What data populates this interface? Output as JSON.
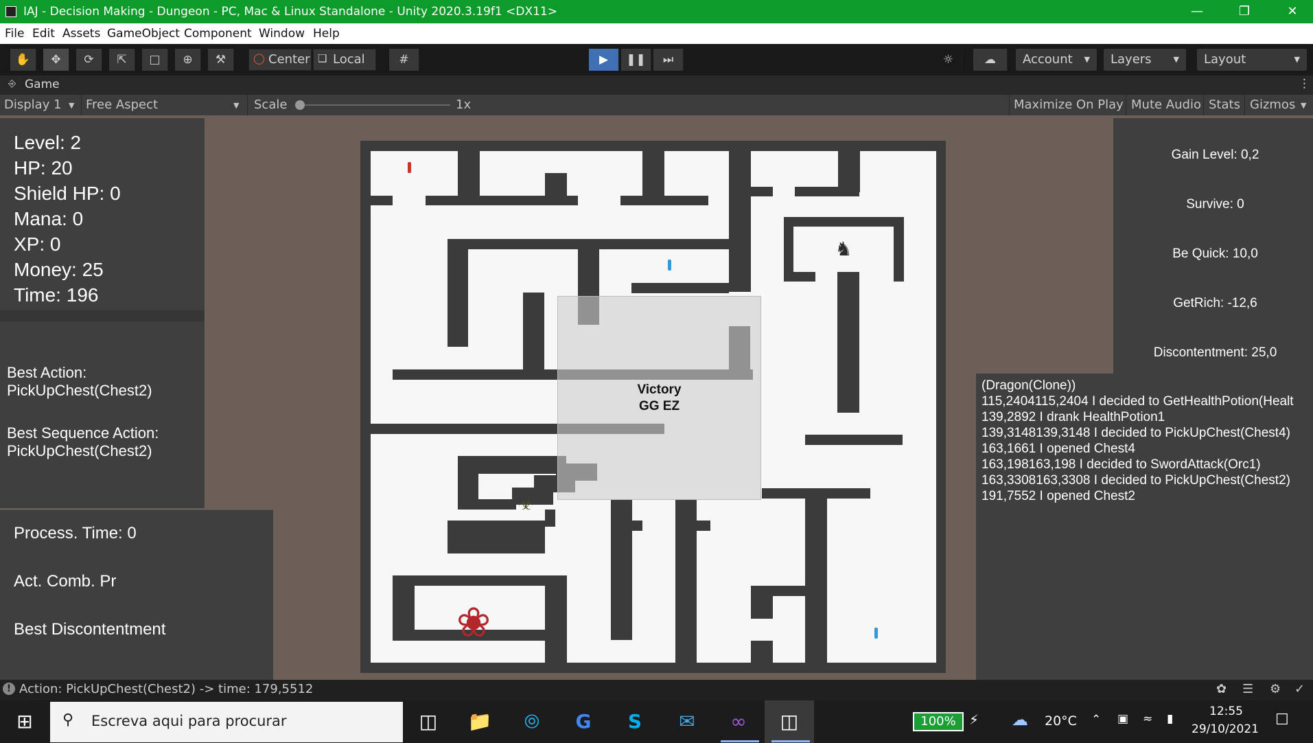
{
  "window": {
    "title": "IAJ - Decision Making - Dungeon - PC, Mac & Linux Standalone - Unity 2020.3.19f1 <DX11>"
  },
  "menu": [
    "File",
    "Edit",
    "Assets",
    "GameObject",
    "Component",
    "Window",
    "Help"
  ],
  "toolbar": {
    "pivot": "Center",
    "space": "Local",
    "account": "Account",
    "layers": "Layers",
    "layout": "Layout"
  },
  "game_tab": {
    "label": "Game",
    "display": "Display 1",
    "aspect": "Free Aspect",
    "scale_label": "Scale",
    "scale_value": "1x",
    "maximize": "Maximize On Play",
    "mute": "Mute Audio",
    "stats": "Stats",
    "gizmos": "Gizmos"
  },
  "stats": {
    "level": "Level: 2",
    "hp": "HP: 20",
    "shield": "Shield HP: 0",
    "mana": "Mana: 0",
    "xp": "XP: 0",
    "money": "Money: 25",
    "time": "Time: 196"
  },
  "best": {
    "action_label": "Best Action:",
    "action_value": "PickUpChest(Chest2)",
    "sequence_label": "Best Sequence Action:",
    "sequence_value": "PickUpChest(Chest2)"
  },
  "process": {
    "time": "Process. Time: 0",
    "comb": "Act. Comb. Pr",
    "discontent": "Best Discontentment"
  },
  "goals": {
    "gain_level": "Gain Level: 0,2",
    "survive": "Survive: 0",
    "be_quick": "Be Quick: 10,0",
    "get_rich": "GetRich: -12,6",
    "discontentment": "Discontentment: 25,0"
  },
  "log": [
    "(Dragon(Clone))",
    "115,2404115,2404 I decided to GetHealthPotion(Healt",
    "139,2892 I drank HealthPotion1",
    "139,3148139,3148 I decided to PickUpChest(Chest4)",
    "163,1661 I opened  Chest4",
    "163,198163,198 I decided to SwordAttack(Orc1)",
    "163,3308163,3308 I decided to PickUpChest(Chest2)",
    "191,7552 I opened  Chest2"
  ],
  "victory": {
    "line1": "Victory",
    "line2": "GG EZ"
  },
  "status": {
    "text": "Action: PickUpChest(Chest2) -> time: 179,5512"
  },
  "taskbar": {
    "search_placeholder": "Escreva aqui para procurar",
    "battery": "100%",
    "weather": "20°C",
    "time": "12:55",
    "date": "29/10/2021"
  },
  "colors": {
    "titlebar": "#0d9b2a",
    "editor_dark": "#191919",
    "game_bg": "#6b5f58",
    "panel": "#3f3f3f",
    "wall": "#3b3b3b",
    "floor": "#f7f7f7"
  }
}
